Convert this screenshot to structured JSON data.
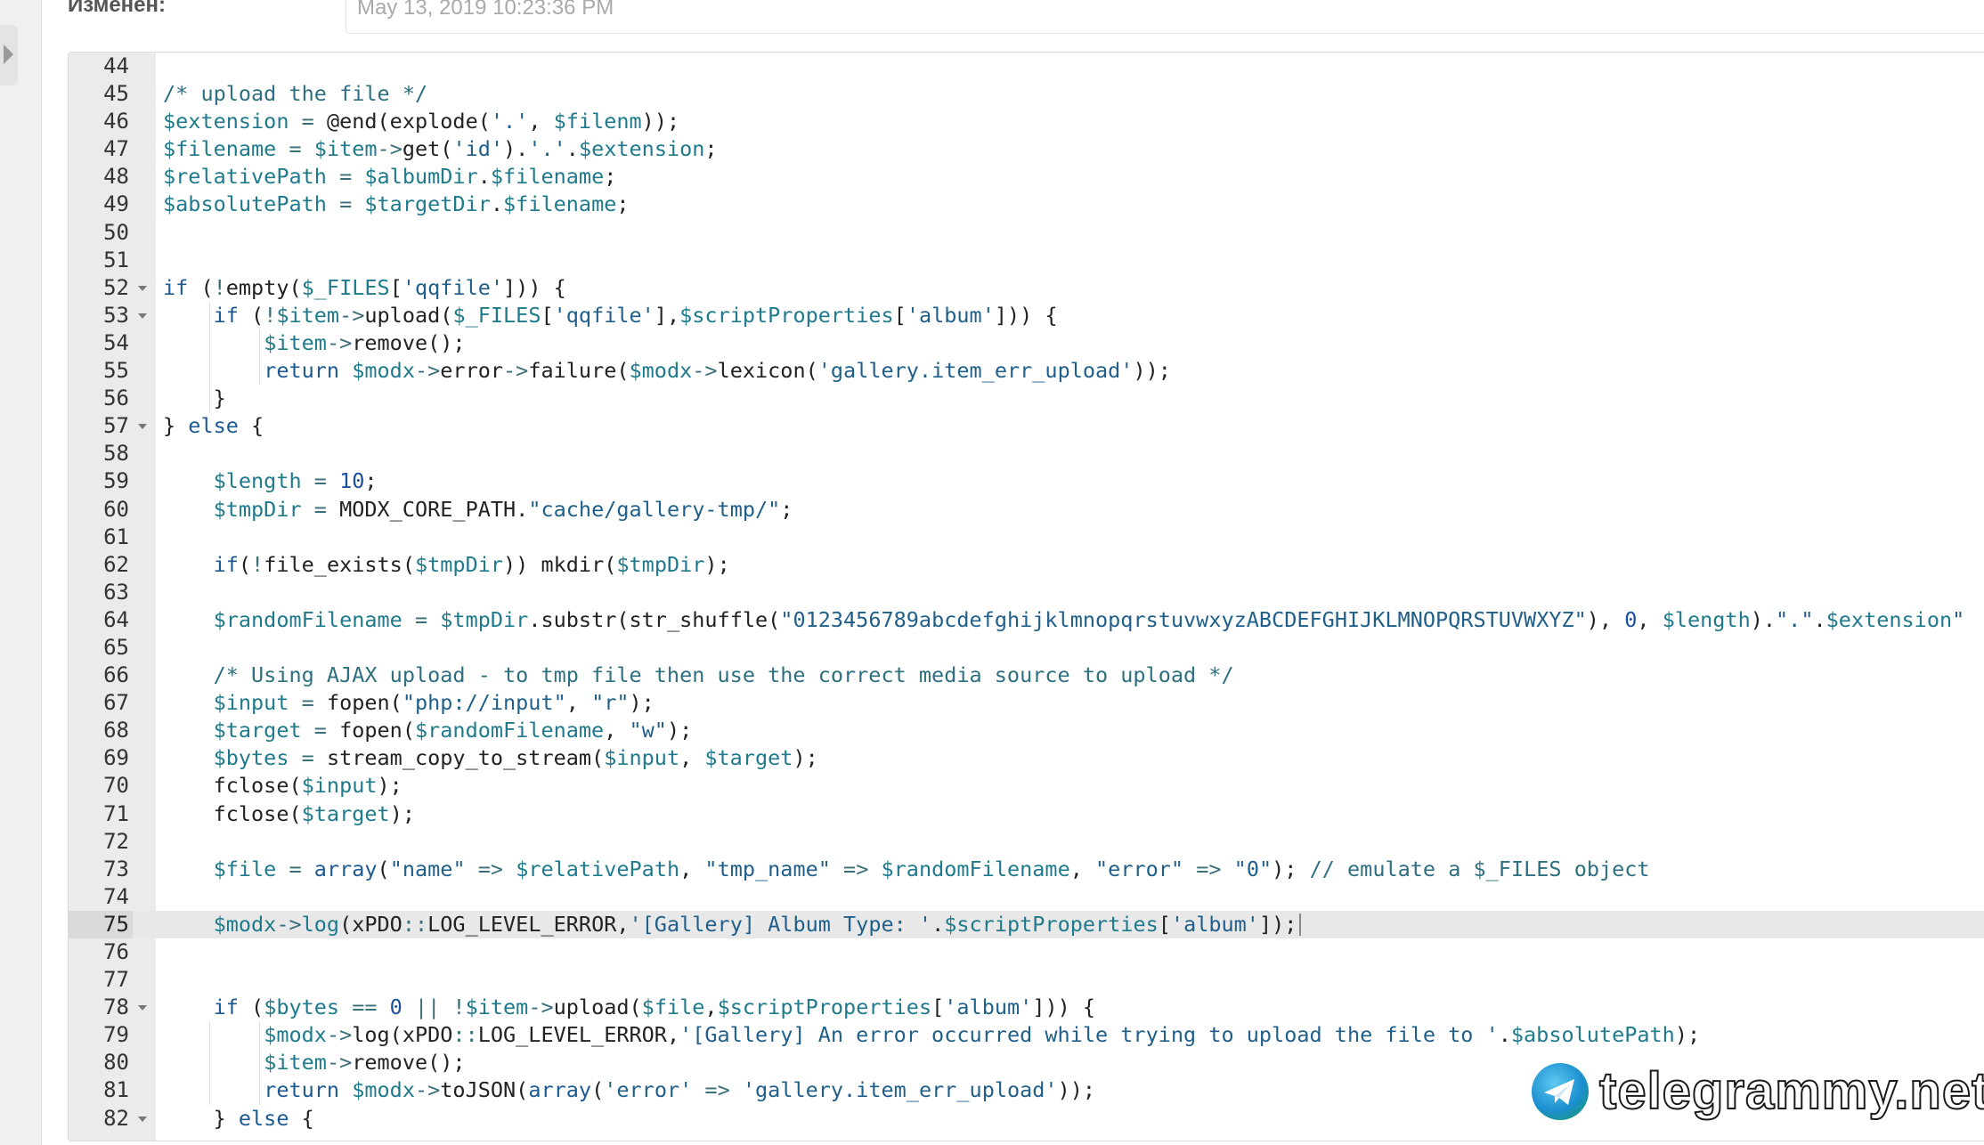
{
  "meta": {
    "label": "Изменен:",
    "value": "May 13, 2019 10:23:36 PM"
  },
  "editor": {
    "active_line": 75,
    "lines": [
      {
        "n": "44",
        "segs": []
      },
      {
        "n": "45",
        "segs": [
          {
            "t": "/* upload the file */",
            "c": "cm"
          }
        ]
      },
      {
        "n": "46",
        "segs": [
          {
            "t": "$extension",
            "c": "v"
          },
          {
            "t": " = ",
            "c": "op"
          },
          {
            "t": "@end(explode(",
            "c": "p"
          },
          {
            "t": "'.'",
            "c": "s"
          },
          {
            "t": ", ",
            "c": "p"
          },
          {
            "t": "$filenm",
            "c": "v"
          },
          {
            "t": "));",
            "c": "p"
          }
        ]
      },
      {
        "n": "47",
        "segs": [
          {
            "t": "$filename",
            "c": "v"
          },
          {
            "t": " = ",
            "c": "op"
          },
          {
            "t": "$item",
            "c": "v"
          },
          {
            "t": "->",
            "c": "op"
          },
          {
            "t": "get(",
            "c": "p"
          },
          {
            "t": "'id'",
            "c": "s"
          },
          {
            "t": ").",
            "c": "p"
          },
          {
            "t": "'.'",
            "c": "s"
          },
          {
            "t": ".",
            "c": "p"
          },
          {
            "t": "$extension",
            "c": "v"
          },
          {
            "t": ";",
            "c": "p"
          }
        ]
      },
      {
        "n": "48",
        "segs": [
          {
            "t": "$relativePath",
            "c": "v"
          },
          {
            "t": " = ",
            "c": "op"
          },
          {
            "t": "$albumDir",
            "c": "v"
          },
          {
            "t": ".",
            "c": "p"
          },
          {
            "t": "$filename",
            "c": "v"
          },
          {
            "t": ";",
            "c": "p"
          }
        ]
      },
      {
        "n": "49",
        "segs": [
          {
            "t": "$absolutePath",
            "c": "v"
          },
          {
            "t": " = ",
            "c": "op"
          },
          {
            "t": "$targetDir",
            "c": "v"
          },
          {
            "t": ".",
            "c": "p"
          },
          {
            "t": "$filename",
            "c": "v"
          },
          {
            "t": ";",
            "c": "p"
          }
        ]
      },
      {
        "n": "50",
        "segs": []
      },
      {
        "n": "51",
        "segs": []
      },
      {
        "n": "52",
        "fold": true,
        "segs": [
          {
            "t": "if",
            "c": "k"
          },
          {
            "t": " (",
            "c": "p"
          },
          {
            "t": "!",
            "c": "op"
          },
          {
            "t": "empty(",
            "c": "p"
          },
          {
            "t": "$_FILES",
            "c": "v"
          },
          {
            "t": "[",
            "c": "p"
          },
          {
            "t": "'qqfile'",
            "c": "s"
          },
          {
            "t": "])) {",
            "c": "p"
          }
        ]
      },
      {
        "n": "53",
        "fold": true,
        "indent": 1,
        "segs": [
          {
            "t": "    ",
            "c": "p"
          },
          {
            "t": "if",
            "c": "k"
          },
          {
            "t": " (",
            "c": "p"
          },
          {
            "t": "!",
            "c": "op"
          },
          {
            "t": "$item",
            "c": "v"
          },
          {
            "t": "->",
            "c": "op"
          },
          {
            "t": "upload(",
            "c": "p"
          },
          {
            "t": "$_FILES",
            "c": "v"
          },
          {
            "t": "[",
            "c": "p"
          },
          {
            "t": "'qqfile'",
            "c": "s"
          },
          {
            "t": "],",
            "c": "p"
          },
          {
            "t": "$scriptProperties",
            "c": "v"
          },
          {
            "t": "[",
            "c": "p"
          },
          {
            "t": "'album'",
            "c": "s"
          },
          {
            "t": "])) {",
            "c": "p"
          }
        ]
      },
      {
        "n": "54",
        "indent": 2,
        "segs": [
          {
            "t": "        ",
            "c": "p"
          },
          {
            "t": "$item",
            "c": "v"
          },
          {
            "t": "->",
            "c": "op"
          },
          {
            "t": "remove();",
            "c": "p"
          }
        ]
      },
      {
        "n": "55",
        "indent": 2,
        "segs": [
          {
            "t": "        ",
            "c": "p"
          },
          {
            "t": "return",
            "c": "k"
          },
          {
            "t": " ",
            "c": "p"
          },
          {
            "t": "$modx",
            "c": "v"
          },
          {
            "t": "->",
            "c": "op"
          },
          {
            "t": "error",
            "c": "p"
          },
          {
            "t": "->",
            "c": "op"
          },
          {
            "t": "failure(",
            "c": "p"
          },
          {
            "t": "$modx",
            "c": "v"
          },
          {
            "t": "->",
            "c": "op"
          },
          {
            "t": "lexicon(",
            "c": "p"
          },
          {
            "t": "'gallery.item_err_upload'",
            "c": "s"
          },
          {
            "t": "));",
            "c": "p"
          }
        ]
      },
      {
        "n": "56",
        "indent": 1,
        "segs": [
          {
            "t": "    }",
            "c": "p"
          }
        ]
      },
      {
        "n": "57",
        "fold": true,
        "segs": [
          {
            "t": "} ",
            "c": "p"
          },
          {
            "t": "else",
            "c": "k"
          },
          {
            "t": " {",
            "c": "p"
          }
        ]
      },
      {
        "n": "58",
        "segs": []
      },
      {
        "n": "59",
        "segs": [
          {
            "t": "    ",
            "c": "p"
          },
          {
            "t": "$length",
            "c": "v"
          },
          {
            "t": " = ",
            "c": "op"
          },
          {
            "t": "10",
            "c": "n"
          },
          {
            "t": ";",
            "c": "p"
          }
        ]
      },
      {
        "n": "60",
        "segs": [
          {
            "t": "    ",
            "c": "p"
          },
          {
            "t": "$tmpDir",
            "c": "v"
          },
          {
            "t": " = ",
            "c": "op"
          },
          {
            "t": "MODX_CORE_PATH.",
            "c": "p"
          },
          {
            "t": "\"cache/gallery-tmp/\"",
            "c": "s"
          },
          {
            "t": ";",
            "c": "p"
          }
        ]
      },
      {
        "n": "61",
        "segs": []
      },
      {
        "n": "62",
        "segs": [
          {
            "t": "    ",
            "c": "p"
          },
          {
            "t": "if",
            "c": "k"
          },
          {
            "t": "(",
            "c": "p"
          },
          {
            "t": "!",
            "c": "op"
          },
          {
            "t": "file_exists(",
            "c": "p"
          },
          {
            "t": "$tmpDir",
            "c": "v"
          },
          {
            "t": ")) mkdir(",
            "c": "p"
          },
          {
            "t": "$tmpDir",
            "c": "v"
          },
          {
            "t": ");",
            "c": "p"
          }
        ]
      },
      {
        "n": "63",
        "segs": []
      },
      {
        "n": "64",
        "segs": [
          {
            "t": "    ",
            "c": "p"
          },
          {
            "t": "$randomFilename",
            "c": "v"
          },
          {
            "t": " = ",
            "c": "op"
          },
          {
            "t": "$tmpDir",
            "c": "v"
          },
          {
            "t": ".substr(str_shuffle(",
            "c": "p"
          },
          {
            "t": "\"0123456789abcdefghijklmnopqrstuvwxyzABCDEFGHIJKLMNOPQRSTUVWXYZ\"",
            "c": "s"
          },
          {
            "t": "), ",
            "c": "p"
          },
          {
            "t": "0",
            "c": "n"
          },
          {
            "t": ", ",
            "c": "p"
          },
          {
            "t": "$length",
            "c": "v"
          },
          {
            "t": ").",
            "c": "p"
          },
          {
            "t": "\".\"",
            "c": "s"
          },
          {
            "t": ".",
            "c": "p"
          },
          {
            "t": "$extension",
            "c": "v"
          },
          {
            "t": "\"",
            "c": "s"
          }
        ]
      },
      {
        "n": "65",
        "segs": []
      },
      {
        "n": "66",
        "segs": [
          {
            "t": "    ",
            "c": "p"
          },
          {
            "t": "/* Using AJAX upload - to tmp file then use the correct media source to upload */",
            "c": "cm"
          }
        ]
      },
      {
        "n": "67",
        "segs": [
          {
            "t": "    ",
            "c": "p"
          },
          {
            "t": "$input",
            "c": "v"
          },
          {
            "t": " = ",
            "c": "op"
          },
          {
            "t": "fopen(",
            "c": "p"
          },
          {
            "t": "\"php://input\"",
            "c": "s"
          },
          {
            "t": ", ",
            "c": "p"
          },
          {
            "t": "\"r\"",
            "c": "s"
          },
          {
            "t": ");",
            "c": "p"
          }
        ]
      },
      {
        "n": "68",
        "segs": [
          {
            "t": "    ",
            "c": "p"
          },
          {
            "t": "$target",
            "c": "v"
          },
          {
            "t": " = ",
            "c": "op"
          },
          {
            "t": "fopen(",
            "c": "p"
          },
          {
            "t": "$randomFilename",
            "c": "v"
          },
          {
            "t": ", ",
            "c": "p"
          },
          {
            "t": "\"w\"",
            "c": "s"
          },
          {
            "t": ");",
            "c": "p"
          }
        ]
      },
      {
        "n": "69",
        "segs": [
          {
            "t": "    ",
            "c": "p"
          },
          {
            "t": "$bytes",
            "c": "v"
          },
          {
            "t": " = ",
            "c": "op"
          },
          {
            "t": "stream_copy_to_stream(",
            "c": "p"
          },
          {
            "t": "$input",
            "c": "v"
          },
          {
            "t": ", ",
            "c": "p"
          },
          {
            "t": "$target",
            "c": "v"
          },
          {
            "t": ");",
            "c": "p"
          }
        ]
      },
      {
        "n": "70",
        "segs": [
          {
            "t": "    ",
            "c": "p"
          },
          {
            "t": "fclose(",
            "c": "p"
          },
          {
            "t": "$input",
            "c": "v"
          },
          {
            "t": ");",
            "c": "p"
          }
        ]
      },
      {
        "n": "71",
        "segs": [
          {
            "t": "    ",
            "c": "p"
          },
          {
            "t": "fclose(",
            "c": "p"
          },
          {
            "t": "$target",
            "c": "v"
          },
          {
            "t": ");",
            "c": "p"
          }
        ]
      },
      {
        "n": "72",
        "segs": []
      },
      {
        "n": "73",
        "segs": [
          {
            "t": "    ",
            "c": "p"
          },
          {
            "t": "$file",
            "c": "v"
          },
          {
            "t": " = ",
            "c": "op"
          },
          {
            "t": "array",
            "c": "k"
          },
          {
            "t": "(",
            "c": "p"
          },
          {
            "t": "\"name\"",
            "c": "s"
          },
          {
            "t": " => ",
            "c": "op"
          },
          {
            "t": "$relativePath",
            "c": "v"
          },
          {
            "t": ", ",
            "c": "p"
          },
          {
            "t": "\"tmp_name\"",
            "c": "s"
          },
          {
            "t": " => ",
            "c": "op"
          },
          {
            "t": "$randomFilename",
            "c": "v"
          },
          {
            "t": ", ",
            "c": "p"
          },
          {
            "t": "\"error\"",
            "c": "s"
          },
          {
            "t": " => ",
            "c": "op"
          },
          {
            "t": "\"0\"",
            "c": "s"
          },
          {
            "t": "); ",
            "c": "p"
          },
          {
            "t": "// emulate a $_FILES object",
            "c": "cm"
          }
        ]
      },
      {
        "n": "74",
        "segs": []
      },
      {
        "n": "75",
        "segs": [
          {
            "t": "    ",
            "c": "p"
          },
          {
            "t": "$modx",
            "c": "v"
          },
          {
            "t": "->",
            "c": "op"
          },
          {
            "t": "log",
            "c": "v"
          },
          {
            "t": "(xPDO",
            "c": "p"
          },
          {
            "t": "::",
            "c": "op"
          },
          {
            "t": "LOG_LEVEL_ERROR,",
            "c": "p"
          },
          {
            "t": "'[Gallery] Album Type: '",
            "c": "s"
          },
          {
            "t": ".",
            "c": "p"
          },
          {
            "t": "$scriptProperties",
            "c": "v"
          },
          {
            "t": "[",
            "c": "p"
          },
          {
            "t": "'album'",
            "c": "s"
          },
          {
            "t": "]);",
            "c": "p"
          }
        ]
      },
      {
        "n": "76",
        "segs": []
      },
      {
        "n": "77",
        "segs": []
      },
      {
        "n": "78",
        "fold": true,
        "segs": [
          {
            "t": "    ",
            "c": "p"
          },
          {
            "t": "if",
            "c": "k"
          },
          {
            "t": " (",
            "c": "p"
          },
          {
            "t": "$bytes",
            "c": "v"
          },
          {
            "t": " == ",
            "c": "op"
          },
          {
            "t": "0",
            "c": "n"
          },
          {
            "t": " || ",
            "c": "op"
          },
          {
            "t": "!",
            "c": "op"
          },
          {
            "t": "$item",
            "c": "v"
          },
          {
            "t": "->",
            "c": "op"
          },
          {
            "t": "upload(",
            "c": "p"
          },
          {
            "t": "$file",
            "c": "v"
          },
          {
            "t": ",",
            "c": "p"
          },
          {
            "t": "$scriptProperties",
            "c": "v"
          },
          {
            "t": "[",
            "c": "p"
          },
          {
            "t": "'album'",
            "c": "s"
          },
          {
            "t": "])) {",
            "c": "p"
          }
        ]
      },
      {
        "n": "79",
        "indent": 2,
        "segs": [
          {
            "t": "        ",
            "c": "p"
          },
          {
            "t": "$modx",
            "c": "v"
          },
          {
            "t": "->",
            "c": "op"
          },
          {
            "t": "log(xPDO",
            "c": "p"
          },
          {
            "t": "::",
            "c": "op"
          },
          {
            "t": "LOG_LEVEL_ERROR,",
            "c": "p"
          },
          {
            "t": "'[Gallery] An error occurred while trying to upload the file to '",
            "c": "s"
          },
          {
            "t": ".",
            "c": "p"
          },
          {
            "t": "$absolutePath",
            "c": "v"
          },
          {
            "t": ");",
            "c": "p"
          }
        ]
      },
      {
        "n": "80",
        "indent": 2,
        "segs": [
          {
            "t": "        ",
            "c": "p"
          },
          {
            "t": "$item",
            "c": "v"
          },
          {
            "t": "->",
            "c": "op"
          },
          {
            "t": "remove();",
            "c": "p"
          }
        ]
      },
      {
        "n": "81",
        "indent": 2,
        "segs": [
          {
            "t": "        ",
            "c": "p"
          },
          {
            "t": "return",
            "c": "k"
          },
          {
            "t": " ",
            "c": "p"
          },
          {
            "t": "$modx",
            "c": "v"
          },
          {
            "t": "->",
            "c": "op"
          },
          {
            "t": "toJSON(",
            "c": "p"
          },
          {
            "t": "array",
            "c": "k"
          },
          {
            "t": "(",
            "c": "p"
          },
          {
            "t": "'error'",
            "c": "s"
          },
          {
            "t": " => ",
            "c": "op"
          },
          {
            "t": "'gallery.item_err_upload'",
            "c": "s"
          },
          {
            "t": "));",
            "c": "p"
          }
        ]
      },
      {
        "n": "82",
        "fold": true,
        "segs": [
          {
            "t": "    } ",
            "c": "p"
          },
          {
            "t": "else",
            "c": "k"
          },
          {
            "t": " {",
            "c": "p"
          }
        ]
      }
    ]
  },
  "colors": {
    "cm": "#2e6f80",
    "v": "#1f7a8c",
    "s": "#1f5f8a",
    "k": "#1d5a92",
    "n": "#1c4f9c",
    "op": "#3a6f7a",
    "p": "#222222"
  },
  "watermark": {
    "text": "telegrammy.net",
    "icon": "telegram-logo-icon"
  },
  "icons": {
    "collapse": "triangle-right-icon",
    "fold": "triangle-down-icon"
  }
}
